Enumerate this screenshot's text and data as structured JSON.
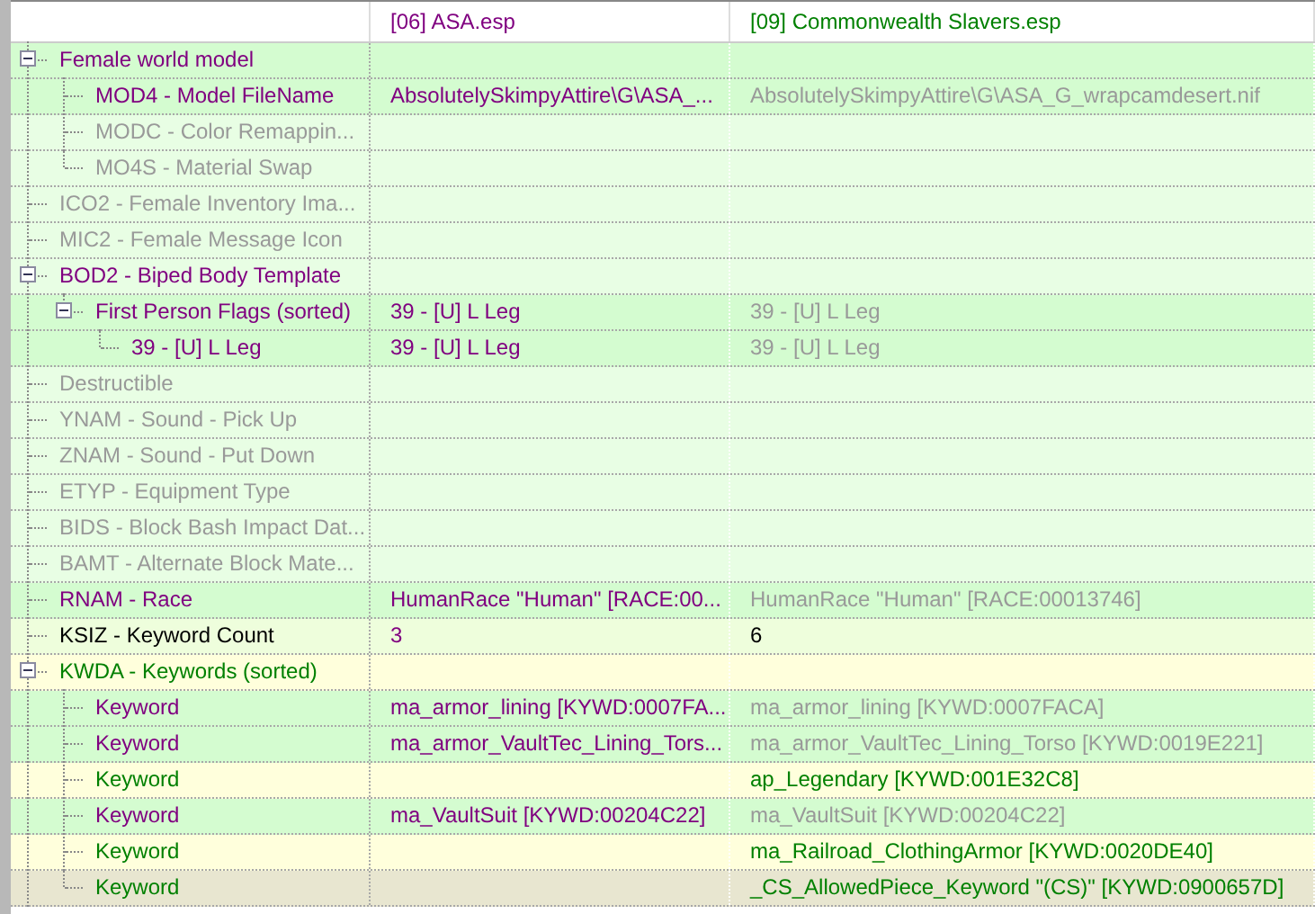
{
  "columns": [
    {
      "text": "[06] ASA.esp",
      "kind": "winner"
    },
    {
      "text": "[09] Commonwealth Slavers.esp",
      "kind": "added"
    }
  ],
  "rows": [
    {
      "kind": "match",
      "label": {
        "text": "Female world model",
        "kind": "winner"
      },
      "expanded": true,
      "children": [
        {
          "kind": "match",
          "label": {
            "text": "MOD4 - Model FileName",
            "kind": "winner"
          },
          "column_2": {
            "text": "AbsolutelySkimpyAttire\\G\\ASA_...",
            "kind": "winner"
          },
          "column_3": {
            "text": "AbsolutelySkimpyAttire\\G\\ASA_G_wrapcamdesert.nif",
            "kind": "ignored"
          }
        },
        {
          "kind": "empty",
          "label": {
            "text": "MODC - Color Remappin...",
            "kind": "ignored"
          }
        },
        {
          "kind": "empty",
          "label": {
            "text": "MO4S - Material Swap",
            "kind": "ignored"
          }
        }
      ]
    },
    {
      "kind": "empty",
      "label": {
        "text": "ICO2 - Female Inventory Ima...",
        "kind": "ignored"
      }
    },
    {
      "kind": "empty",
      "label": {
        "text": "MIC2 - Female Message Icon",
        "kind": "ignored"
      }
    },
    {
      "kind": "empty",
      "label": {
        "text": "BOD2 - Biped Body Template",
        "kind": "winner"
      },
      "expanded": true,
      "children": [
        {
          "kind": "match",
          "label": {
            "text": "First Person Flags (sorted)",
            "kind": "winner"
          },
          "column_2": {
            "text": "39 - [U] L Leg",
            "kind": "winner"
          },
          "column_3": {
            "text": "39 - [U] L Leg",
            "kind": "ignored"
          },
          "expanded": true,
          "children": [
            {
              "kind": "match",
              "label": {
                "text": "39 - [U] L Leg",
                "kind": "winner"
              },
              "column_2": {
                "text": "39 - [U] L Leg",
                "kind": "winner"
              },
              "column_3": {
                "text": "39 - [U] L Leg",
                "kind": "ignored"
              }
            }
          ]
        }
      ]
    },
    {
      "kind": "empty",
      "label": {
        "text": "Destructible",
        "kind": "ignored"
      }
    },
    {
      "kind": "empty",
      "label": {
        "text": "YNAM - Sound - Pick Up",
        "kind": "ignored"
      }
    },
    {
      "kind": "empty",
      "label": {
        "text": "ZNAM - Sound - Put Down",
        "kind": "ignored"
      }
    },
    {
      "kind": "empty",
      "label": {
        "text": "ETYP - Equipment Type",
        "kind": "ignored"
      }
    },
    {
      "kind": "empty",
      "label": {
        "text": "BIDS - Block Bash Impact Dat...",
        "kind": "ignored"
      }
    },
    {
      "kind": "empty",
      "label": {
        "text": "BAMT - Alternate Block Mate...",
        "kind": "ignored"
      }
    },
    {
      "kind": "match",
      "label": {
        "text": "RNAM - Race",
        "kind": "winner"
      },
      "column_2": {
        "text": "HumanRace \"Human\" [RACE:00...",
        "kind": "winner"
      },
      "column_3": {
        "text": "HumanRace \"Human\" [RACE:00013746]",
        "kind": "ignored"
      }
    },
    {
      "kind": "count",
      "label": {
        "text": "KSIZ - Keyword Count",
        "kind": "plain"
      },
      "column_2": {
        "text": "3",
        "kind": "winner"
      },
      "column_3": {
        "text": "6",
        "kind": "plain"
      }
    },
    {
      "kind": "new",
      "label": {
        "text": "KWDA - Keywords (sorted)",
        "kind": "added"
      },
      "expanded": true,
      "children": [
        {
          "kind": "match",
          "label": {
            "text": "Keyword",
            "kind": "winner"
          },
          "column_2": {
            "text": "ma_armor_lining [KYWD:0007FA...",
            "kind": "winner"
          },
          "column_3": {
            "text": "ma_armor_lining [KYWD:0007FACA]",
            "kind": "ignored"
          }
        },
        {
          "kind": "match",
          "label": {
            "text": "Keyword",
            "kind": "winner"
          },
          "column_2": {
            "text": "ma_armor_VaultTec_Lining_Tors...",
            "kind": "winner"
          },
          "column_3": {
            "text": "ma_armor_VaultTec_Lining_Torso [KYWD:0019E221]",
            "kind": "ignored"
          }
        },
        {
          "kind": "new",
          "label": {
            "text": "Keyword",
            "kind": "added"
          },
          "column_3": {
            "text": "ap_Legendary [KYWD:001E32C8]",
            "kind": "added"
          }
        },
        {
          "kind": "match",
          "label": {
            "text": "Keyword",
            "kind": "winner"
          },
          "column_2": {
            "text": "ma_VaultSuit [KYWD:00204C22]",
            "kind": "winner"
          },
          "column_3": {
            "text": "ma_VaultSuit [KYWD:00204C22]",
            "kind": "ignored"
          }
        },
        {
          "kind": "new",
          "label": {
            "text": "Keyword",
            "kind": "added"
          },
          "column_3": {
            "text": "ma_Railroad_ClothingArmor [KYWD:0020DE40]",
            "kind": "added"
          }
        },
        {
          "kind": "error",
          "label": {
            "text": "Keyword",
            "kind": "added"
          },
          "column_3": {
            "text": "_CS_AllowedPiece_Keyword \"(CS)\" [KYWD:0900657D]",
            "kind": "added"
          }
        }
      ]
    }
  ]
}
